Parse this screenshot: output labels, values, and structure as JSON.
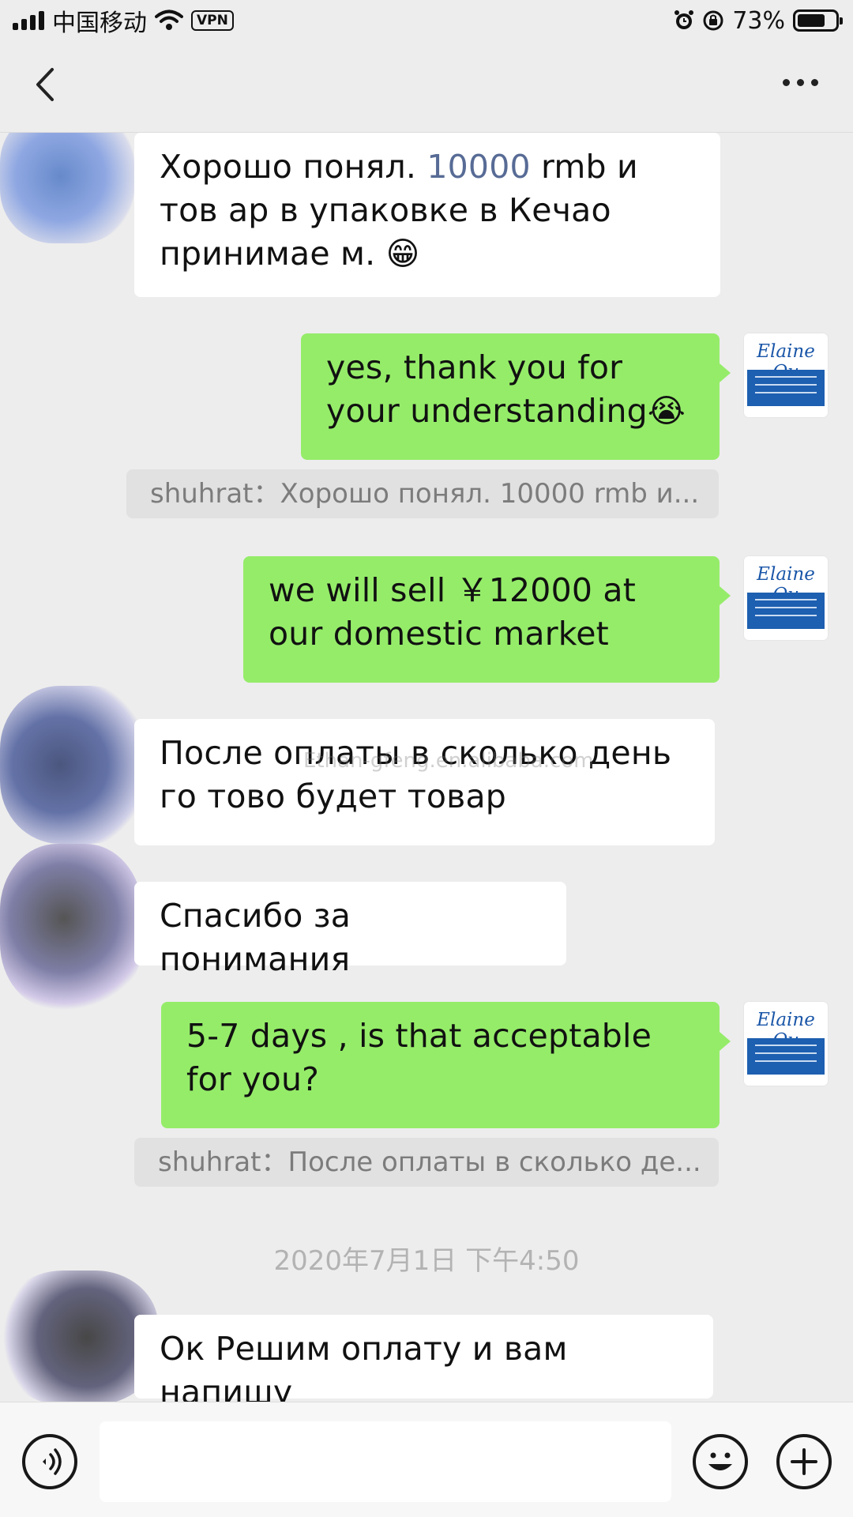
{
  "status_bar": {
    "carrier": "中国移动",
    "vpn": "VPN",
    "battery": "73%",
    "battery_level": 0.73,
    "icons": [
      "signal-icon",
      "wifi-icon",
      "alarm-icon",
      "rotation-lock-icon",
      "battery-icon"
    ]
  },
  "nav": {
    "back_icon": "chevron-left-icon",
    "more_icon": "more-dots-icon"
  },
  "messages": [
    {
      "side": "in",
      "text_before": "Хорошо понял. ",
      "highlight": "10000",
      "text_after": " rmb и тов ар в упаковке в Кечао принимае м. 😁"
    },
    {
      "side": "out",
      "text": "yes, thank you for your understanding😭"
    },
    {
      "side": "quote",
      "text": "shuhrat：Хорошо понял. 10000 rmb и..."
    },
    {
      "side": "out",
      "text": "we will sell ￥12000 at our domestic market"
    },
    {
      "side": "in",
      "text": "После оплаты в сколько день го тово будет товар"
    },
    {
      "side": "in",
      "text": "Спасибо за понимания"
    },
    {
      "side": "out",
      "text": "5-7 days , is that acceptable for you?"
    },
    {
      "side": "quote",
      "text": "shuhrat：После оплаты в сколько де..."
    },
    {
      "side": "in",
      "text": "Ок Решим оплату и вам напишу"
    }
  ],
  "timestamp": "2020年7月1日 下午4:50",
  "watermark": "Ethan-gfeng.en.alibaba.com",
  "avatar": {
    "name": "Elaine Qu",
    "line1": "Shanghai Xunuan",
    "line2": "International Trade Co.,Ltd"
  },
  "colors": {
    "background": "#ededed",
    "incoming_bubble": "#ffffff",
    "outgoing_bubble": "#95ec69",
    "quote_bg": "#e1e1e1",
    "link": "#576b95"
  },
  "input_bar": {
    "voice_icon": "voice-icon",
    "emoji_icon": "emoji-icon",
    "plus_icon": "plus-icon"
  }
}
